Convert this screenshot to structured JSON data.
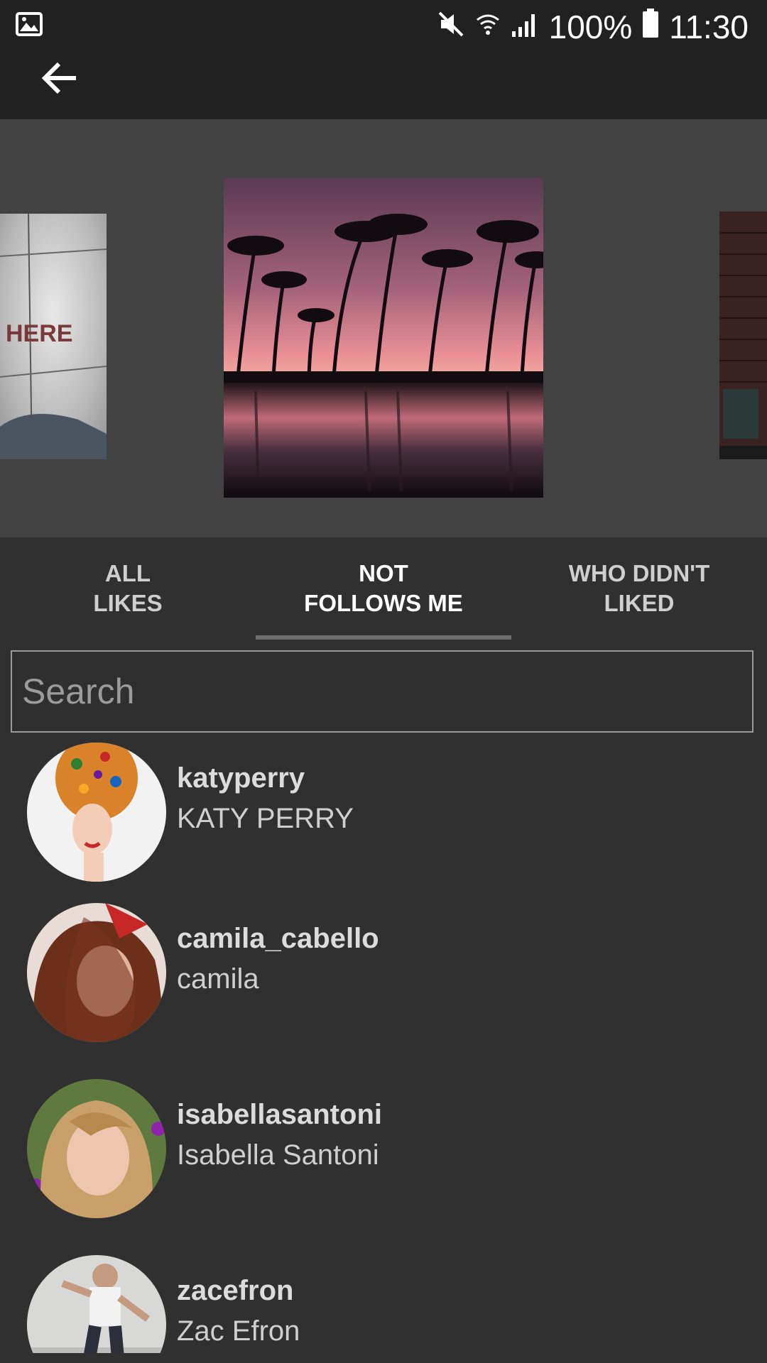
{
  "status_bar": {
    "battery": "100%",
    "time": "11:30",
    "icons": [
      "gallery-icon",
      "mute-icon",
      "wifi-icon",
      "signal-icon",
      "battery-icon"
    ]
  },
  "toolbar": {
    "back_icon": "arrow-left-icon"
  },
  "carousel": {
    "left_photo_text": "HERE"
  },
  "tabs": [
    {
      "line1": "ALL",
      "line2": "LIKES"
    },
    {
      "line1": "NOT",
      "line2": "FOLLOWS ME"
    },
    {
      "line1": "WHO DIDN'T",
      "line2": "LIKED"
    }
  ],
  "active_tab": 1,
  "search": {
    "placeholder": "Search",
    "value": ""
  },
  "users": [
    {
      "username": "katyperry",
      "name": "KATY PERRY"
    },
    {
      "username": "camila_cabello",
      "name": "camila"
    },
    {
      "username": "isabellasantoni",
      "name": "Isabella Santoni"
    },
    {
      "username": "zacefron",
      "name": "Zac Efron"
    }
  ],
  "colors": {
    "background": "#303030",
    "header": "#212121",
    "carousel": "#424242"
  }
}
